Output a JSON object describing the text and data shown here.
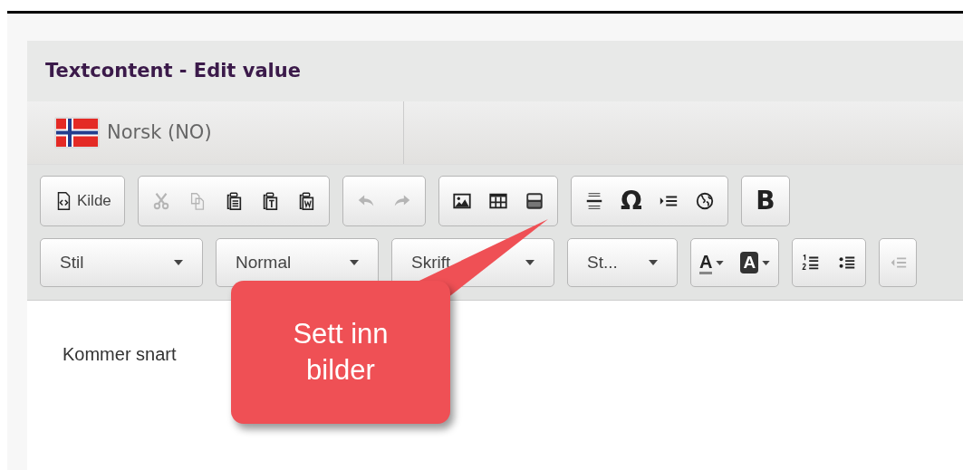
{
  "dialog": {
    "title": "Textcontent - Edit value"
  },
  "language_tabs": [
    {
      "label": "Norsk (NO)",
      "selected": true
    }
  ],
  "toolbar": {
    "rows": [
      [
        {
          "items": [
            {
              "kind": "source",
              "label": "Kilde",
              "disabled": false
            }
          ]
        },
        {
          "items": [
            {
              "kind": "cut",
              "disabled": true
            },
            {
              "kind": "copy",
              "disabled": true
            },
            {
              "kind": "paste",
              "disabled": false
            },
            {
              "kind": "pastetext",
              "disabled": false
            },
            {
              "kind": "pasteword",
              "disabled": false
            }
          ]
        },
        {
          "items": [
            {
              "kind": "undo",
              "disabled": true
            },
            {
              "kind": "redo",
              "disabled": true
            }
          ]
        },
        {
          "items": [
            {
              "kind": "image",
              "disabled": false
            },
            {
              "kind": "table",
              "disabled": false
            },
            {
              "kind": "video",
              "disabled": false
            }
          ]
        },
        {
          "items": [
            {
              "kind": "rule",
              "disabled": false
            },
            {
              "kind": "glyph",
              "label": "Ω",
              "disabled": false
            },
            {
              "kind": "indent",
              "disabled": false
            },
            {
              "kind": "globe",
              "disabled": false
            }
          ]
        },
        {
          "items": [
            {
              "kind": "glyph",
              "label": "B",
              "disabled": false
            }
          ]
        }
      ],
      [
        {
          "items": [
            {
              "kind": "dropdown",
              "label": "Stil",
              "disabled": false
            }
          ]
        },
        {
          "items": [
            {
              "kind": "dropdown",
              "label": "Normal",
              "disabled": false
            }
          ]
        },
        {
          "items": [
            {
              "kind": "dropdown",
              "label": "Skrift",
              "disabled": false
            }
          ]
        },
        {
          "items": [
            {
              "kind": "dropdown",
              "label": "St...",
              "disabled": false,
              "narrow": true
            }
          ]
        },
        {
          "items": [
            {
              "kind": "textcolor",
              "label": "A",
              "disabled": false
            },
            {
              "kind": "bgcolor",
              "label": "A",
              "disabled": false
            }
          ]
        },
        {
          "items": [
            {
              "kind": "ol",
              "disabled": false
            },
            {
              "kind": "ul",
              "disabled": false
            }
          ]
        },
        {
          "items": [
            {
              "kind": "outdent",
              "disabled": true
            }
          ]
        }
      ]
    ]
  },
  "editor": {
    "text": "Kommer snart"
  },
  "callout": {
    "text": "Sett inn bilder"
  }
}
